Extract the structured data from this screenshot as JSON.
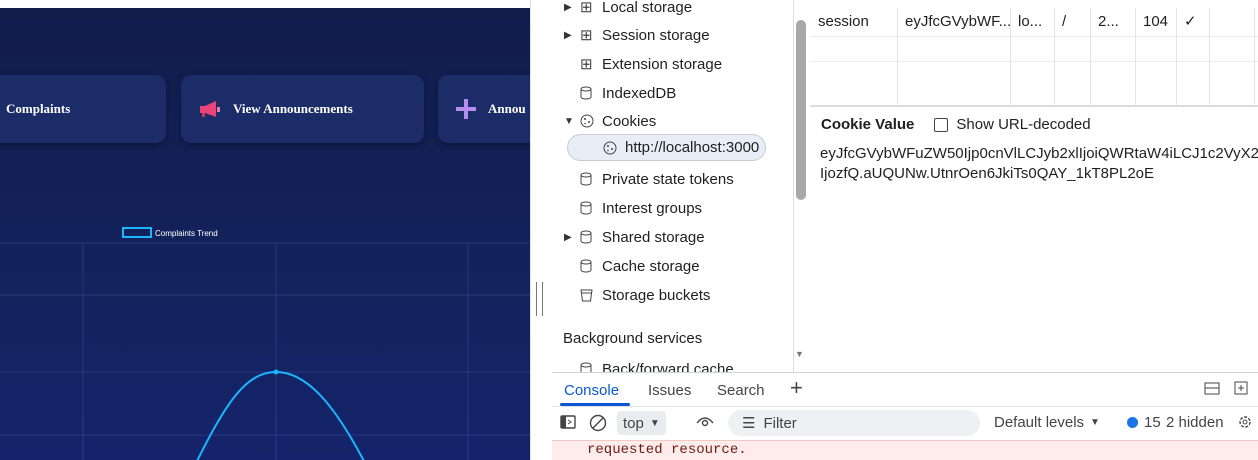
{
  "app": {
    "nav_cards": [
      {
        "label": "Complaints"
      },
      {
        "label": "View Announcements"
      },
      {
        "label": "Annou"
      }
    ],
    "chart_data": {
      "type": "line",
      "legend": [
        "Complaints Trend"
      ],
      "series": [
        {
          "name": "Complaints Trend",
          "color": "#1ab6ff"
        }
      ],
      "grid": true,
      "legend_position": "top-center"
    },
    "colors": {
      "background": "#132158",
      "card": "#1c2c68",
      "line": "#1ab6ff",
      "megaphone": "#e8447a",
      "plus": "#b78cf0"
    }
  },
  "storage_tree": {
    "items": [
      {
        "label": "Local storage",
        "icon": "grid-icon",
        "expandable": true
      },
      {
        "label": "Session storage",
        "icon": "grid-icon",
        "expandable": true
      },
      {
        "label": "Extension storage",
        "icon": "grid-icon",
        "expandable": false
      },
      {
        "label": "IndexedDB",
        "icon": "database-icon",
        "expandable": false
      },
      {
        "label": "Cookies",
        "icon": "cookie-icon",
        "expandable": true,
        "expanded": true
      },
      {
        "label": "http://localhost:3000",
        "icon": "cookie-icon",
        "selected": true
      },
      {
        "label": "Private state tokens",
        "icon": "database-icon"
      },
      {
        "label": "Interest groups",
        "icon": "database-icon"
      },
      {
        "label": "Shared storage",
        "icon": "database-icon",
        "expandable": true
      },
      {
        "label": "Cache storage",
        "icon": "database-icon"
      },
      {
        "label": "Storage buckets",
        "icon": "bucket-icon"
      }
    ],
    "section_heading": "Background services",
    "bf_cache": "Back/forward cache"
  },
  "cookie_table": {
    "row": {
      "name": "session",
      "value": "eyJfcGVybWF...",
      "domain": "lo...",
      "path": "/",
      "expires": "2...",
      "size": "104",
      "httponly": "✓"
    }
  },
  "cookie_value": {
    "title": "Cookie Value",
    "checkbox_label": "Show URL-decoded",
    "line1": "eyJfcGVybWFuZW50Ijp0cnVlLCJyb2xlIjoiQWRtaW4iLCJ1c2VyX2",
    "line2": "IjozfQ.aUQUNw.UtnrOen6JkiTs0QAY_1kT8PL2oE"
  },
  "drawer": {
    "tabs": [
      "Console",
      "Issues",
      "Search"
    ],
    "context": "top",
    "filter_placeholder": "Filter",
    "levels": "Default levels",
    "issues_count": "15",
    "hidden": "2 hidden",
    "message": "requested resource."
  }
}
